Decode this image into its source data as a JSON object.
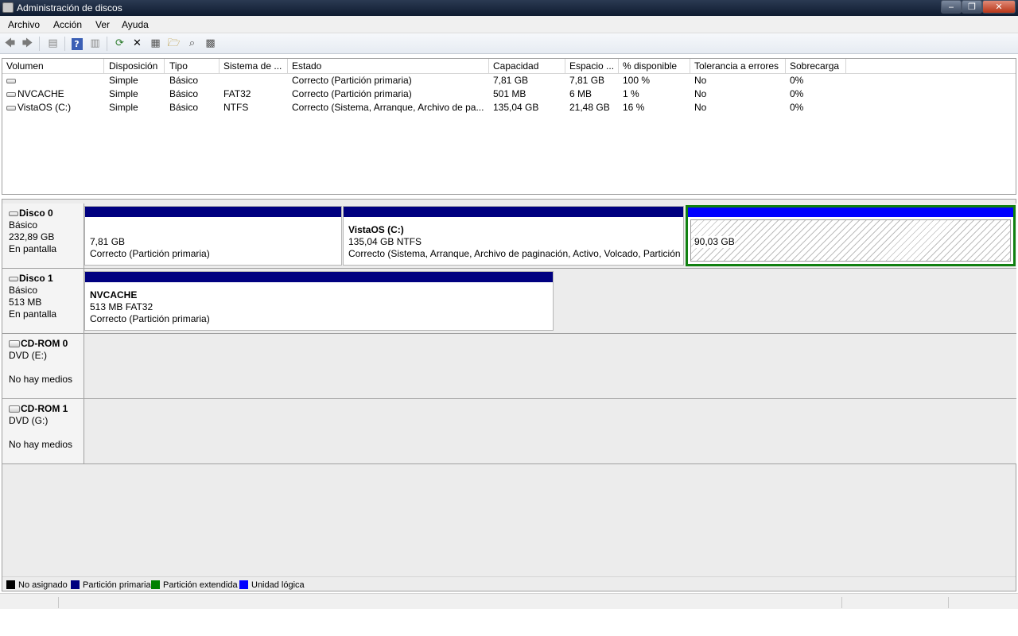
{
  "window": {
    "title": "Administración de discos"
  },
  "menu": [
    "Archivo",
    "Acción",
    "Ver",
    "Ayuda"
  ],
  "toolbar": {
    "icons": [
      "back-icon",
      "forward-icon",
      "console-tree-icon",
      "help-icon",
      "show-pane-icon",
      "refresh-icon",
      "delete-icon",
      "properties-icon",
      "open-icon",
      "explore-icon",
      "format-icon"
    ]
  },
  "volumes": {
    "headers": [
      "Volumen",
      "Disposición",
      "Tipo",
      "Sistema de ...",
      "Estado",
      "Capacidad",
      "Espacio ...",
      "% disponible",
      "Tolerancia a errores",
      "Sobrecarga"
    ],
    "rows": [
      [
        "",
        "Simple",
        "Básico",
        "",
        "Correcto (Partición primaria)",
        "7,81 GB",
        "7,81 GB",
        "100 %",
        "No",
        "0%"
      ],
      [
        "NVCACHE",
        "Simple",
        "Básico",
        "FAT32",
        "Correcto (Partición primaria)",
        "501 MB",
        "6 MB",
        "1 %",
        "No",
        "0%"
      ],
      [
        "VistaOS (C:)",
        "Simple",
        "Básico",
        "NTFS",
        "Correcto (Sistema, Arranque, Archivo de pa...",
        "135,04 GB",
        "21,48 GB",
        "16 %",
        "No",
        "0%"
      ]
    ]
  },
  "disks": [
    {
      "name": "Disco 0",
      "type": "Básico",
      "size": "232,89 GB",
      "status": "En pantalla",
      "partitions": [
        {
          "name": "",
          "size": "7,81 GB",
          "status": "Correcto (Partición primaria)"
        },
        {
          "name": "VistaOS  (C:)",
          "size": "135,04 GB NTFS",
          "status": "Correcto (Sistema, Arranque, Archivo de paginación, Activo, Volcado, Partición"
        },
        {
          "name": "",
          "size": "90,03 GB",
          "status": ""
        }
      ]
    },
    {
      "name": "Disco 1",
      "type": "Básico",
      "size": "513 MB",
      "status": "En pantalla",
      "partitions": [
        {
          "name": "NVCACHE",
          "size": "513 MB FAT32",
          "status": "Correcto (Partición primaria)"
        }
      ]
    },
    {
      "name": "CD-ROM 0",
      "type": "DVD (E:)",
      "status": "No hay medios"
    },
    {
      "name": "CD-ROM 1",
      "type": "DVD (G:)",
      "status": "No hay medios"
    }
  ],
  "legend": [
    {
      "label": "No asignado",
      "color": "#000000"
    },
    {
      "label": "Partición primaria",
      "color": "#000080"
    },
    {
      "label": "Partición extendida",
      "color": "#008000"
    },
    {
      "label": "Unidad lógica",
      "color": "#0000ff"
    }
  ]
}
